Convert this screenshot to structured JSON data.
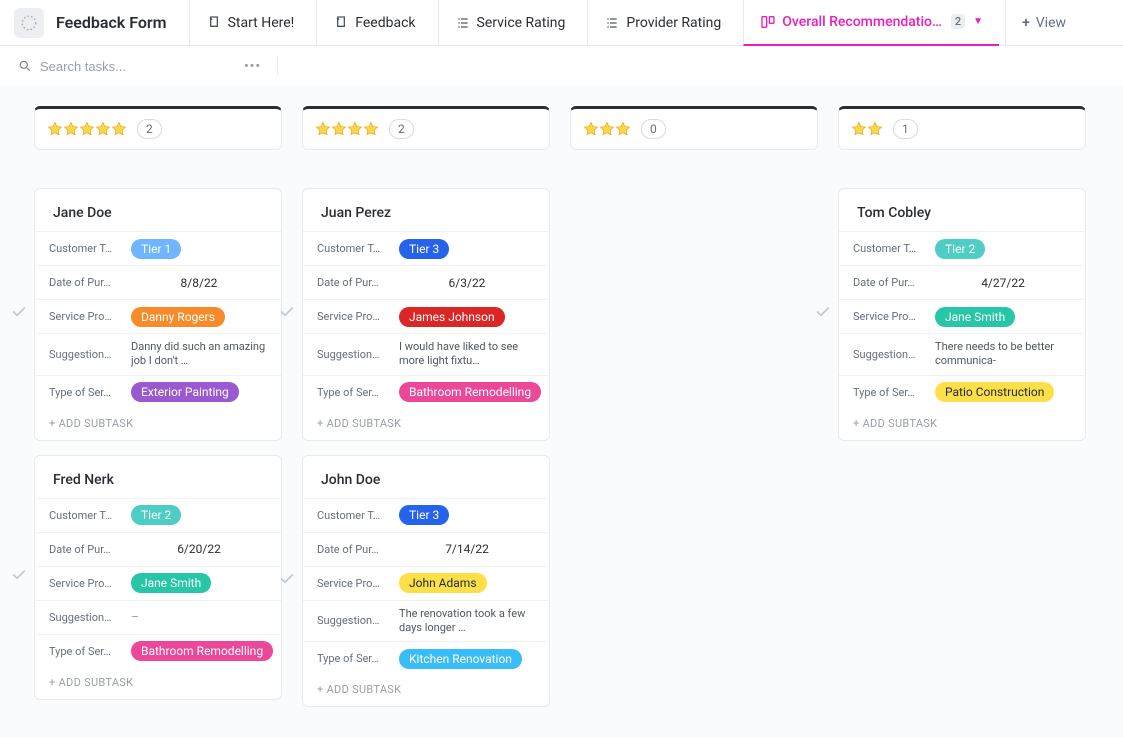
{
  "header": {
    "app_title": "Feedback Form",
    "tabs": [
      {
        "label": "Start Here!"
      },
      {
        "label": "Feedback"
      },
      {
        "label": "Service Rating"
      },
      {
        "label": "Provider Rating"
      },
      {
        "label": "Overall Recommendatio…",
        "badge": "2"
      }
    ],
    "add_view_label": "View"
  },
  "secondary": {
    "search_placeholder": "Search tasks..."
  },
  "field_labels": {
    "tier": "Customer T…",
    "date": "Date of Pur…",
    "provider": "Service Pro…",
    "suggestions": "Suggestion…",
    "service_type": "Type of Ser…"
  },
  "add_subtask_label": "+ ADD SUBTASK",
  "columns": [
    {
      "stars": 5,
      "count": "2",
      "cards": [
        {
          "name": "Jane Doe",
          "tier": {
            "text": "Tier 1",
            "bg": "#6fb5ff"
          },
          "date": "8/8/22",
          "provider": {
            "text": "Danny Rogers",
            "bg": "#f78b2a"
          },
          "suggestions": "Danny did such an amazing job I don't …",
          "service": {
            "text": "Exterior Painting",
            "bg": "#9b59d0"
          }
        },
        {
          "name": "Fred Nerk",
          "tier": {
            "text": "Tier 2",
            "bg": "#4ecdc4"
          },
          "date": "6/20/22",
          "provider": {
            "text": "Jane Smith",
            "bg": "#26c6a6"
          },
          "suggestions": "–",
          "service": {
            "text": "Bathroom Remodelling",
            "bg": "#ec4899"
          }
        }
      ]
    },
    {
      "stars": 4,
      "count": "2",
      "cards": [
        {
          "name": "Juan Perez",
          "tier": {
            "text": "Tier 3",
            "bg": "#2563eb",
            "fg": "#fff"
          },
          "date": "6/3/22",
          "provider": {
            "text": "James Johnson",
            "bg": "#dc2626"
          },
          "suggestions": "I would have liked to see more light fixtu…",
          "service": {
            "text": "Bathroom Remodelling",
            "bg": "#ec4899"
          }
        },
        {
          "name": "John Doe",
          "tier": {
            "text": "Tier 3",
            "bg": "#2563eb",
            "fg": "#fff"
          },
          "date": "7/14/22",
          "provider": {
            "text": "John Adams",
            "bg": "#fde047",
            "fg": "#1f2937"
          },
          "suggestions": "The renovation took a few days longer …",
          "service": {
            "text": "Kitchen Renovation",
            "bg": "#38bdf8"
          }
        }
      ]
    },
    {
      "stars": 3,
      "count": "0",
      "cards": []
    },
    {
      "stars": 2,
      "count": "1",
      "cards": [
        {
          "name": "Tom Cobley",
          "tier": {
            "text": "Tier 2",
            "bg": "#4ecdc4"
          },
          "date": "4/27/22",
          "provider": {
            "text": "Jane Smith",
            "bg": "#26c6a6"
          },
          "suggestions": "There needs to be better communica-",
          "service": {
            "text": "Patio Construction",
            "bg": "#fde047",
            "fg": "#1f2937"
          }
        }
      ]
    }
  ]
}
